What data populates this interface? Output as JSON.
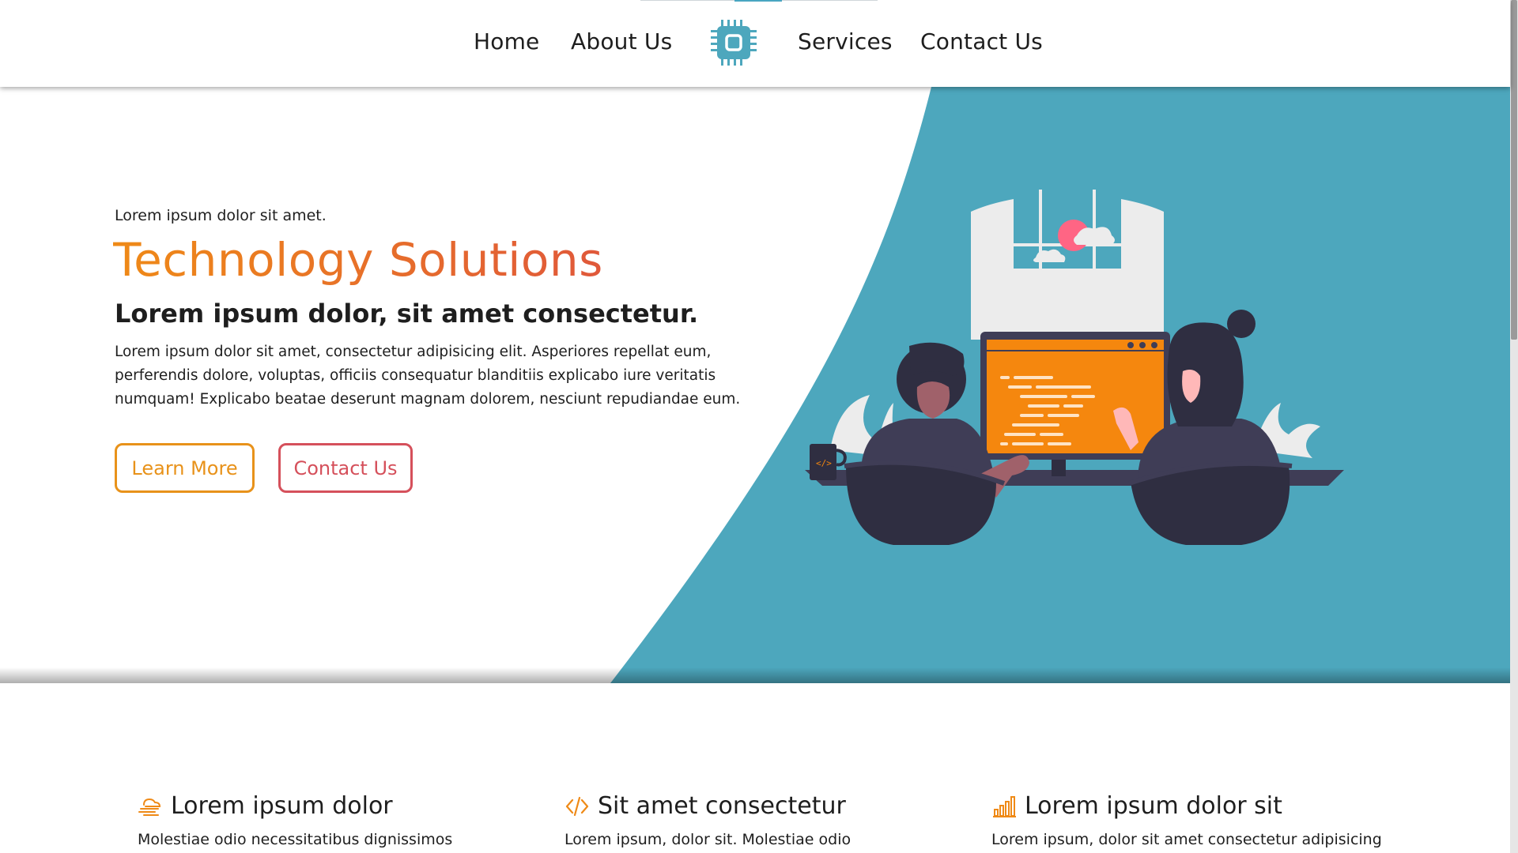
{
  "nav": {
    "home": "Home",
    "about": "About Us",
    "services": "Services",
    "contact": "Contact Us",
    "logo_icon": "cpu-chip-icon"
  },
  "hero": {
    "eyebrow": "Lorem ipsum dolor sit amet.",
    "title": "Technology Solutions",
    "subtitle": "Lorem ipsum dolor, sit amet consectetur.",
    "body": "Lorem ipsum dolor sit amet, consectetur adipisicing elit. Asperiores repellat eum, perferendis dolore, voluptas, officiis consequatur blanditiis explicabo iure veritatis numquam! Explicabo beatae deserunt magnam dolorem, nesciunt repudiandae eum.",
    "learn_more": "Learn More",
    "contact_us": "Contact Us",
    "illustration": "two-people-coding-at-computer-illustration"
  },
  "features": [
    {
      "icon": "cloud-wind-icon",
      "title": "Lorem ipsum dolor",
      "text": "Molestiae odio necessitatibus dignissimos"
    },
    {
      "icon": "code-icon",
      "title": "Sit amet consectetur",
      "text": "Lorem ipsum, dolor sit. Molestiae odio"
    },
    {
      "icon": "bar-chart-icon",
      "title": "Lorem ipsum dolor sit",
      "text": "Lorem ipsum, dolor sit amet consectetur adipisicing"
    }
  ],
  "colors": {
    "teal": "#4da7bd",
    "orange": "#f5870e",
    "title_gradient_start": "#ef8a17",
    "title_gradient_end": "#e0583a",
    "learn_more_border": "#e8921a",
    "contact_border": "#d5505b",
    "dark_figure": "#2f2e41"
  }
}
